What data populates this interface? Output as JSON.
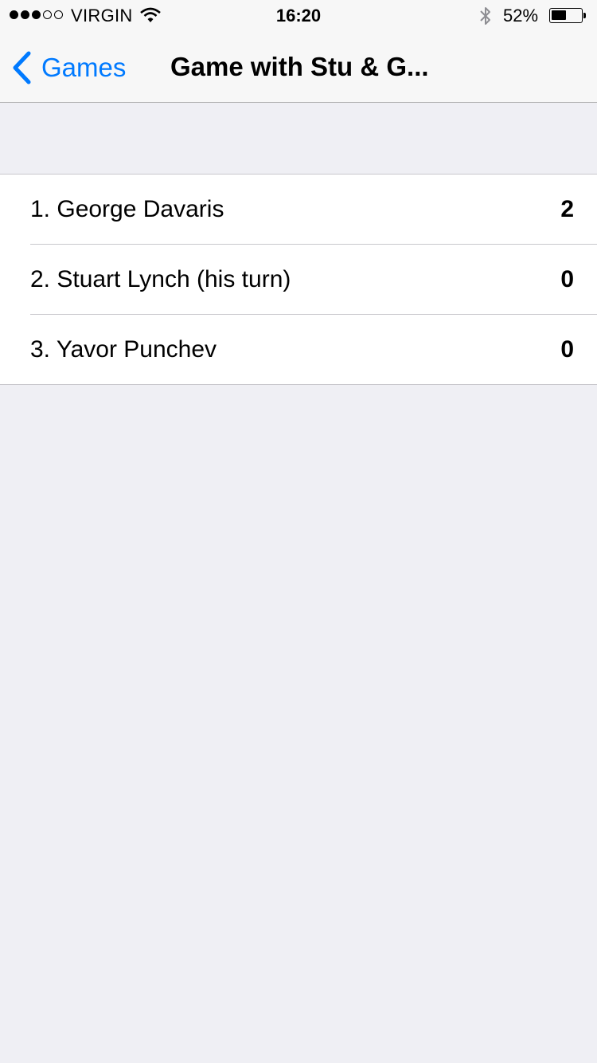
{
  "status_bar": {
    "carrier": "VIRGIN",
    "time": "16:20",
    "battery_percent": "52%",
    "battery_level": 0.52,
    "signal_bars_filled": 3,
    "signal_bars_total": 5,
    "icons": [
      "wifi-icon",
      "bluetooth-icon",
      "battery-icon"
    ]
  },
  "nav": {
    "back_label": "Games",
    "title": "Game with Stu & G..."
  },
  "players": [
    {
      "name": "1. George Davaris",
      "score": "2"
    },
    {
      "name": "2. Stuart Lynch (his turn)",
      "score": "0"
    },
    {
      "name": "3. Yavor Punchev",
      "score": "0"
    }
  ],
  "colors": {
    "accent": "#007aff",
    "background": "#efeff4",
    "nav_background": "#f7f7f7",
    "separator": "#c8c7cc"
  }
}
